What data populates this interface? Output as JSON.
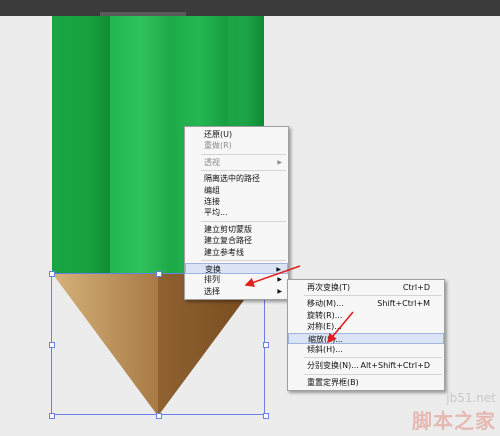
{
  "context_menu": {
    "items": [
      {
        "label": "还原(U)",
        "disabled": false
      },
      {
        "label": "重做(R)",
        "disabled": true
      },
      {
        "sep": true
      },
      {
        "label": "透视",
        "disabled": true,
        "submenu": true
      },
      {
        "sep": true
      },
      {
        "label": "隔离选中的路径",
        "disabled": false
      },
      {
        "label": "编组",
        "disabled": false
      },
      {
        "label": "连接",
        "disabled": false
      },
      {
        "label": "平均...",
        "disabled": false
      },
      {
        "sep": true
      },
      {
        "label": "建立剪切蒙版",
        "disabled": false
      },
      {
        "label": "建立复合路径",
        "disabled": false
      },
      {
        "label": "建立参考线",
        "disabled": false
      },
      {
        "sep": true
      },
      {
        "label": "变换",
        "submenu": true,
        "active": true
      },
      {
        "label": "排列",
        "submenu": true
      },
      {
        "label": "选择",
        "submenu": true
      }
    ]
  },
  "transform_submenu": {
    "items": [
      {
        "label": "再次变换(T)",
        "shortcut": "Ctrl+D"
      },
      {
        "sep": true
      },
      {
        "label": "移动(M)...",
        "shortcut": "Shift+Ctrl+M"
      },
      {
        "label": "旋转(R)...",
        "shortcut": ""
      },
      {
        "label": "对称(E)...",
        "shortcut": ""
      },
      {
        "label": "缩放(S)...",
        "shortcut": "",
        "active": true
      },
      {
        "label": "倾斜(H)...",
        "shortcut": ""
      },
      {
        "sep": true
      },
      {
        "label": "分别变换(N)...",
        "shortcut": "Alt+Shift+Ctrl+D"
      },
      {
        "sep": true
      },
      {
        "label": "重置定界框(B)",
        "shortcut": ""
      }
    ]
  },
  "watermark": {
    "site": "jb51.net",
    "brand": "脚本之家"
  },
  "colors": {
    "pencil_green_dark": "#0e8f35",
    "pencil_green_light": "#2fc35a",
    "wood_light": "#c9a36a",
    "wood_dark": "#7a4f22",
    "selection": "#6a80e6",
    "annotation_arrow": "#e02020"
  }
}
